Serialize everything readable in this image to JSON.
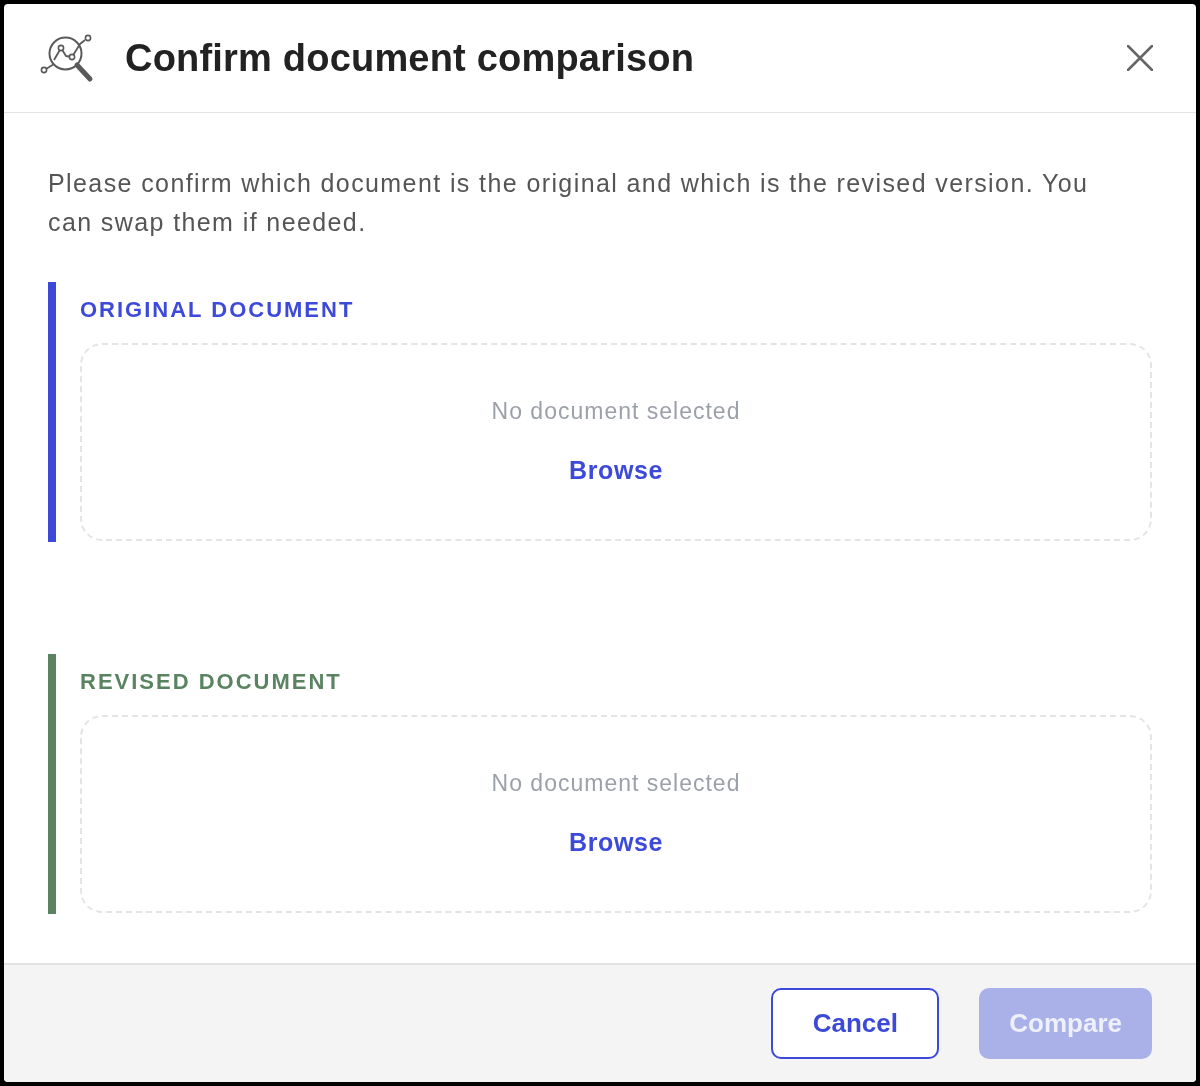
{
  "dialog": {
    "title": "Confirm document comparison",
    "description": "Please confirm which document is the original and which is the revised version. You can swap them if needed.",
    "sections": [
      {
        "label": "ORIGINAL DOCUMENT",
        "color": "#3c49d9",
        "dropzone": {
          "status": "No document selected",
          "action": "Browse"
        }
      },
      {
        "label": "REVISED DOCUMENT",
        "color": "#5a8461",
        "dropzone": {
          "status": "No document selected",
          "action": "Browse"
        }
      }
    ],
    "buttons": [
      {
        "label": "Cancel",
        "kind": "secondary",
        "disabled": false
      },
      {
        "label": "Compare",
        "kind": "primary",
        "disabled": true
      }
    ]
  }
}
